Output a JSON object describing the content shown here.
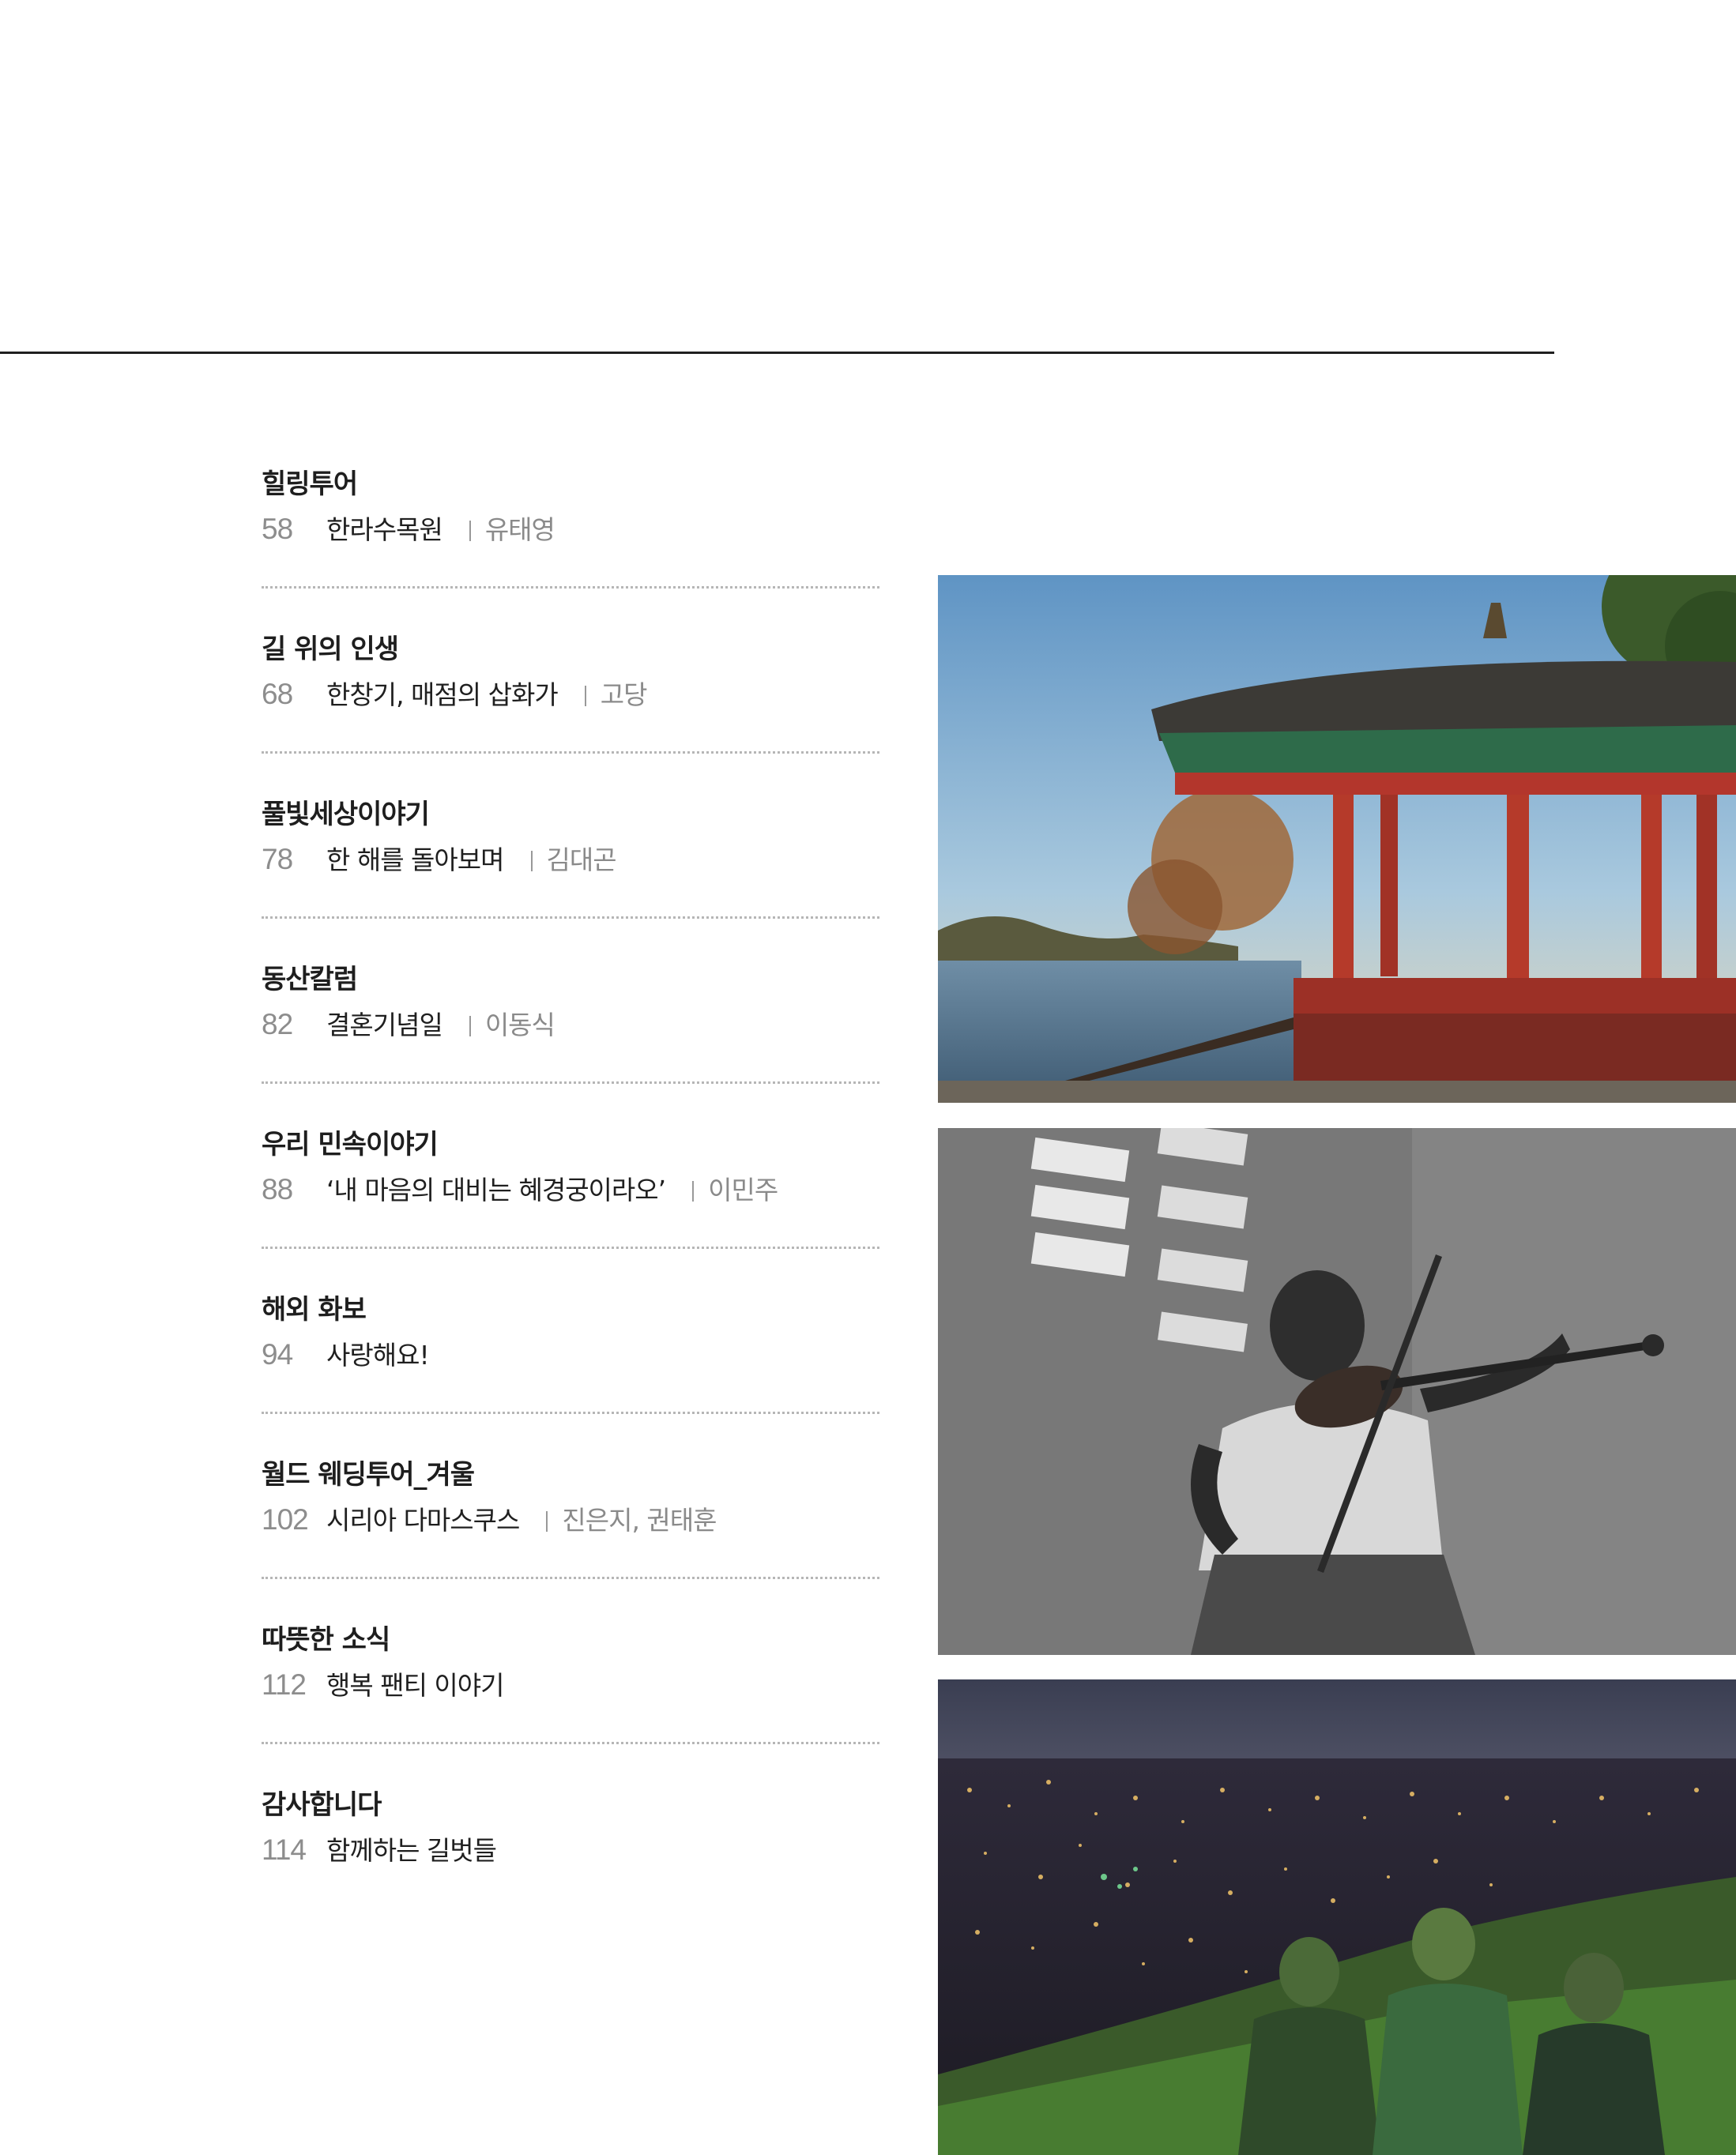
{
  "toc": [
    {
      "section": "힐링투어",
      "page": "58",
      "title": "한라수목원",
      "author": "유태영"
    },
    {
      "section": "길 위의 인생",
      "page": "68",
      "title": "한창기, 매점의 삽화가",
      "author": "고당"
    },
    {
      "section": "풀빛세상이야기",
      "page": "78",
      "title": "한 해를 돌아보며",
      "author": "김대곤"
    },
    {
      "section": "동산칼럼",
      "page": "82",
      "title": "결혼기념일",
      "author": "이동식"
    },
    {
      "section": "우리 민속이야기",
      "page": "88",
      "title": "‘내 마음의 대비는 혜경궁이라오’",
      "author": "이민주"
    },
    {
      "section": "해외 화보",
      "page": "94",
      "title": "사랑해요!",
      "author": ""
    },
    {
      "section": "월드 웨딩투어_겨울",
      "page": "102",
      "title": "시리아 다마스쿠스",
      "author": "진은지, 권태훈"
    },
    {
      "section": "따뜻한 소식",
      "page": "112",
      "title": "행복 팬티 이야기",
      "author": ""
    },
    {
      "section": "감사합니다",
      "page": "114",
      "title": "함께하는 길벗들",
      "author": ""
    }
  ],
  "photos": {
    "pavilion": {
      "icon": "pavilion-photo"
    },
    "violin": {
      "icon": "violin-girl-photo"
    },
    "city": {
      "icon": "night-city-children-photo"
    }
  },
  "colors": {
    "page_number": "#8d8d8d",
    "author": "#8a8a8a",
    "dotted_rule": "#b6b6b6",
    "top_rule": "#1f1f1f"
  }
}
